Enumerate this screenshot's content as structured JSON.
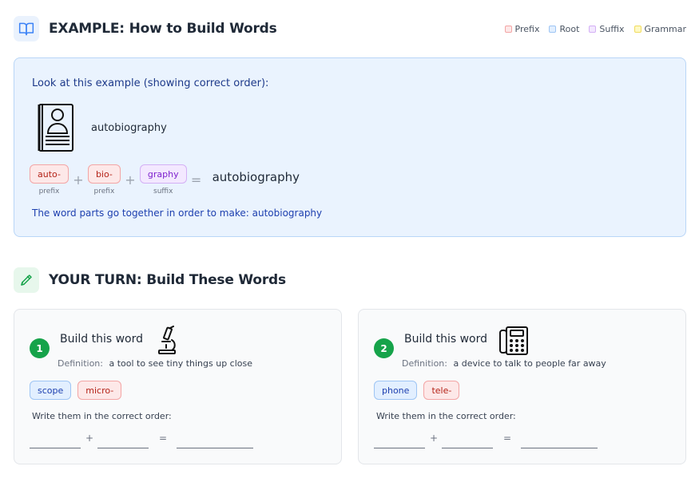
{
  "example_section": {
    "title": "EXAMPLE: How to Build Words",
    "icon": "book-open-icon"
  },
  "legend": [
    {
      "label": "Prefix",
      "color": "#f3a5a5"
    },
    {
      "label": "Root",
      "color": "#9ec5f4"
    },
    {
      "label": "Suffix",
      "color": "#d4b0f5"
    },
    {
      "label": "Grammar",
      "color": "#f1dc60"
    }
  ],
  "example": {
    "intro": "Look at this example (showing correct order):",
    "image_icon": "biography-book-icon",
    "word": "autobiography",
    "parts": [
      {
        "text": "auto-",
        "type": "prefix",
        "label": "prefix"
      },
      {
        "text": "bio-",
        "type": "prefix",
        "label": "prefix"
      },
      {
        "text": "graphy",
        "type": "suffix",
        "label": "suffix"
      }
    ],
    "plus": "+",
    "equals": "=",
    "result": "autobiography",
    "footer": "The word parts go together in order to make: autobiography"
  },
  "turn_section": {
    "title": "YOUR TURN: Build These Words",
    "icon": "pencil-icon"
  },
  "exercises": [
    {
      "number": "1",
      "title": "Build this word",
      "image_icon": "microscope-icon",
      "definition_label": "Definition:",
      "definition": "a tool to see tiny things up close",
      "parts": [
        {
          "text": "scope",
          "type": "root"
        },
        {
          "text": "micro-",
          "type": "prefix"
        }
      ],
      "instruction": "Write them in the correct order:",
      "plus": "+",
      "equals": "="
    },
    {
      "number": "2",
      "title": "Build this word",
      "image_icon": "telephone-icon",
      "definition_label": "Definition:",
      "definition": "a device to talk to people far away",
      "parts": [
        {
          "text": "phone",
          "type": "root"
        },
        {
          "text": "tele-",
          "type": "prefix"
        }
      ],
      "instruction": "Write them in the correct order:",
      "plus": "+",
      "equals": "="
    }
  ]
}
